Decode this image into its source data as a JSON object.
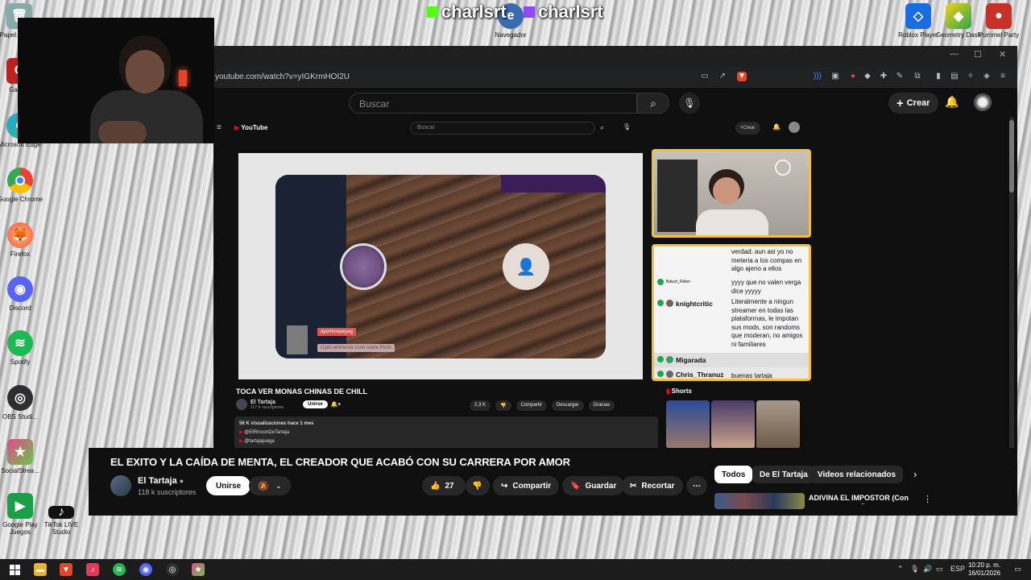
{
  "overlay": {
    "stream_name_left": "charlsrt",
    "stream_name_right": "charlsrt"
  },
  "desktop_icons_left": [
    {
      "label": "Papel... reci..."
    },
    {
      "label": "Gami..."
    },
    {
      "label": "Microsoft Edge"
    },
    {
      "label": "Google Chrome"
    },
    {
      "label": "Firefox"
    },
    {
      "label": "Discord"
    },
    {
      "label": "Spotify"
    },
    {
      "label": "OBS Studi..."
    },
    {
      "label": "SocialStrea..."
    },
    {
      "label": "Google Play Juegos"
    },
    {
      "label": "TikTok LIVE Studio"
    }
  ],
  "desktop_icons_top": [
    {
      "label": "Navegador"
    },
    {
      "label": "Roblox Player"
    },
    {
      "label": "Geometry Dash"
    },
    {
      "label": "Pummel Party"
    }
  ],
  "browser": {
    "url": "youtube.com/watch?v=yIGKrmHOI2U"
  },
  "yt_header": {
    "search_placeholder": "Buscar",
    "create_label": "Crear"
  },
  "embedded": {
    "logo": "YouTube",
    "search_placeholder": "Buscar",
    "create_label": "Crear",
    "video_chat_name": "ayurhrequeyag",
    "video_chat_msg": "Cipto emmenta conti Adela Plchir",
    "title": "TOCA VER MONAS CHINAS DE CHILL",
    "channel": "El Tartaja",
    "subs": "117 K suscriptores",
    "join": "Unirse",
    "likes": "2,3 K",
    "share": "Compartir",
    "download": "Descargar",
    "thanks": "Gracias",
    "views": "56 K visualizaciones  hace 1 mes",
    "link1": "@ElRinconDeTartaja",
    "link2": "@tartajajuega",
    "shorts": "Shorts",
    "chat": [
      {
        "user": "",
        "msg": "verdad: aun asi yo no meteria a los compas en algo ajeno a ellos"
      },
      {
        "user": "Batuzt_Riden",
        "msg": "yyyy que no valen verga dice yyyyy"
      },
      {
        "user": "knightcritic",
        "msg": "Literalmente a ningun streamer en todas las plataformas, le impotan sus mods, son randoms que moderan, no amigos ni familiares"
      },
      {
        "user": "Migarada",
        "msg": ""
      },
      {
        "user": "Chris_Thranuz",
        "msg": "buenas tartaja"
      }
    ]
  },
  "video": {
    "title": "EL EXITO Y LA CAÍDA DE MENTA, EL CREADOR QUE ACABÓ CON SU CARRERA POR AMOR",
    "channel": "El Tartaja",
    "subs": "118 k suscriptores",
    "join": "Unirse",
    "likes": "27",
    "share": "Compartir",
    "save": "Guardar",
    "clip": "Recortar"
  },
  "filters": [
    "Todos",
    "De El Tartaja",
    "Videos relacionados"
  ],
  "recommended": {
    "title": "ADIVINA EL IMPOSTOR (Con Rivelo y Lato) 😂"
  },
  "taskbar": {
    "lang": "ESP",
    "time": "10:20 p. m.",
    "date": "16/01/2026"
  }
}
